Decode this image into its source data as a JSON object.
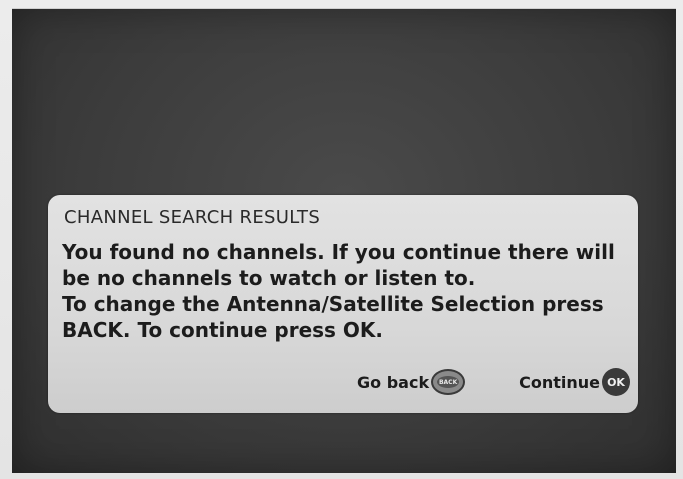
{
  "dialog": {
    "title": "CHANNEL SEARCH RESULTS",
    "body_lines": [
      "You found no channels. If you continue there will",
      "be no channels to watch or listen to.",
      "To change the Antenna/Satellite Selection press",
      "BACK. To continue press OK."
    ],
    "actions": {
      "back": {
        "label": "Go back",
        "icon": "back-key-icon",
        "key_text": "BACK"
      },
      "continue": {
        "label": "Continue",
        "icon": "ok-key-icon",
        "key_text": "OK"
      }
    }
  },
  "colors": {
    "screen_background": "#3c3c3c",
    "dialog_background": "#d8d8d8",
    "text": "#1c1c1c"
  }
}
